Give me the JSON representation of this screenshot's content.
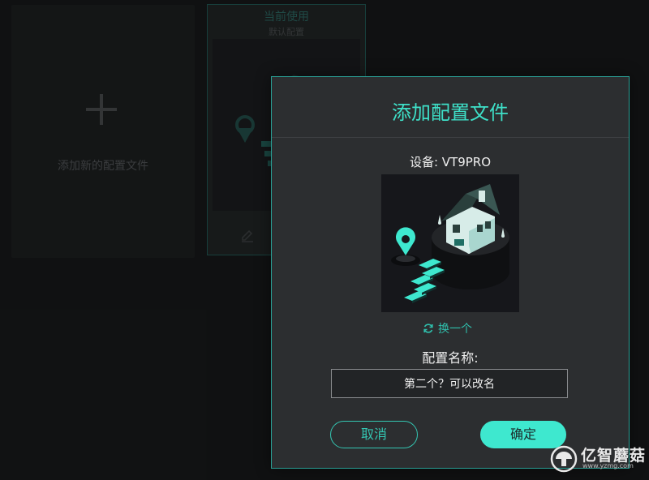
{
  "background": {
    "new_profile_label": "添加新的配置文件",
    "current_card": {
      "title": "当前使用",
      "subtitle": "默认配置"
    }
  },
  "dialog": {
    "title": "添加配置文件",
    "device_label": "设备: VT9PRO",
    "swap_label": "换一个",
    "name_label": "配置名称:",
    "name_value": "第二个？可以改名",
    "cancel_label": "取消",
    "ok_label": "确定"
  },
  "watermark": {
    "brand": "亿智蘑菇",
    "url": "www.yzmg.com"
  },
  "colors": {
    "accent": "#3ee0c8",
    "dialog_border": "#2a9f95",
    "dialog_bg": "#2c2e30",
    "page_bg": "#141516"
  },
  "icons": [
    "plus-icon",
    "edit-icon",
    "delete-icon",
    "refresh-icon",
    "house-illustration",
    "location-pin-icon",
    "mushroom-logo-icon"
  ]
}
